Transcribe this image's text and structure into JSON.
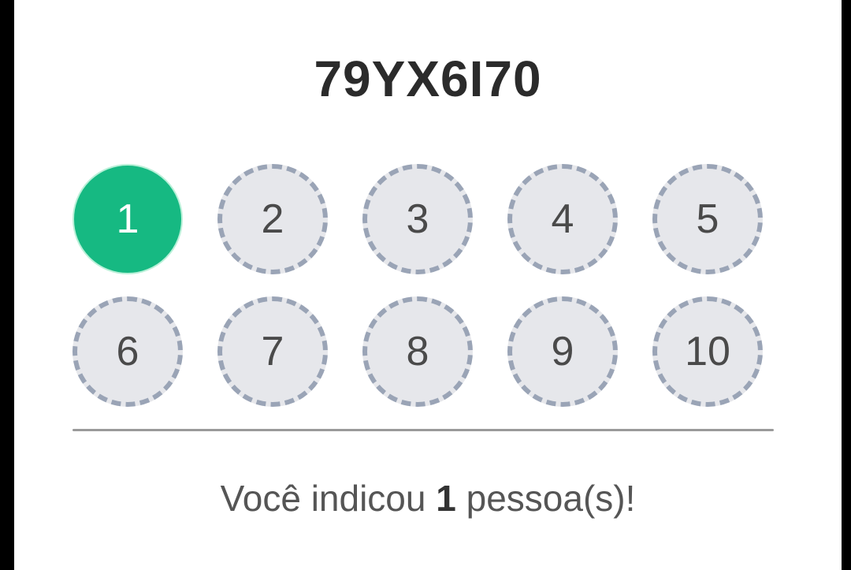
{
  "referral": {
    "code": "79YX6I70",
    "count": "1",
    "message_prefix": "Você indicou ",
    "message_suffix": " pessoa(s)!"
  },
  "slots": [
    {
      "label": "1",
      "filled": true
    },
    {
      "label": "2",
      "filled": false
    },
    {
      "label": "3",
      "filled": false
    },
    {
      "label": "4",
      "filled": false
    },
    {
      "label": "5",
      "filled": false
    },
    {
      "label": "6",
      "filled": false
    },
    {
      "label": "7",
      "filled": false
    },
    {
      "label": "8",
      "filled": false
    },
    {
      "label": "9",
      "filled": false
    },
    {
      "label": "10",
      "filled": false
    }
  ],
  "colors": {
    "filled": "#16b982",
    "empty": "#e6e7eb",
    "dash": "#9aa4b6"
  }
}
